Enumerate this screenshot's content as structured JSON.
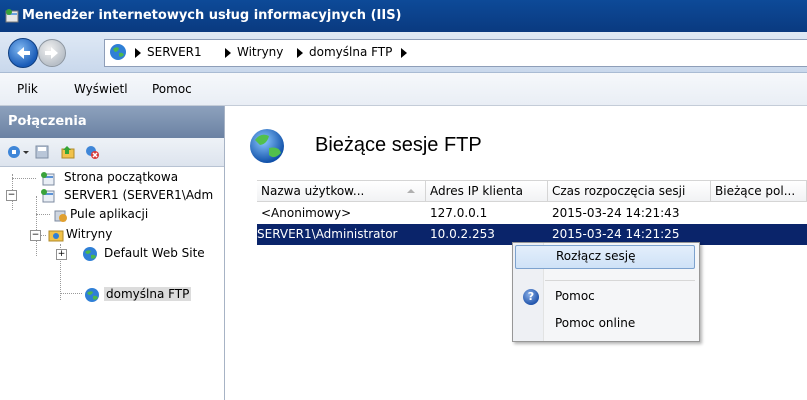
{
  "window": {
    "title": "Menedżer internetowych usług informacyjnych (IIS)"
  },
  "breadcrumb": {
    "items": [
      "SERVER1",
      "Witryny",
      "domyślna FTP"
    ]
  },
  "menu": {
    "items": [
      "Plik",
      "Wyświetl",
      "Pomoc"
    ]
  },
  "connections": {
    "header": "Połączenia",
    "tree": [
      {
        "label": "Strona początkowa"
      },
      {
        "label": "SERVER1 (SERVER1\\Adm"
      },
      {
        "label": "Pule aplikacji"
      },
      {
        "label": "Witryny"
      },
      {
        "label": "Default Web Site"
      },
      {
        "label": "domyślna FTP"
      }
    ]
  },
  "page": {
    "title": "Bieżące sesje FTP"
  },
  "grid": {
    "columns": [
      "Nazwa użytkow...",
      "Adres IP klienta",
      "Czas rozpoczęcia sesji",
      "Bieżące pol..."
    ],
    "rows": [
      {
        "user": "<Anonimowy>",
        "ip": "127.0.0.1",
        "start": "2015-03-24 14:21:43",
        "current": ""
      },
      {
        "user": "SERVER1\\Administrator",
        "ip": "10.0.2.253",
        "start": "2015-03-24 14:21:25",
        "current": ""
      }
    ]
  },
  "context_menu": {
    "items": [
      "Rozłącz sesję",
      "Pomoc",
      "Pomoc online"
    ]
  },
  "colors": {
    "title_bar": "#0d4a98",
    "selection": "#0a246a",
    "menu_highlight": "#cfe2f7"
  }
}
